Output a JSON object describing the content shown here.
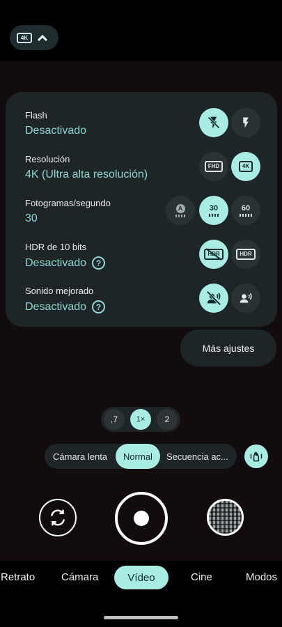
{
  "top_chip": {
    "resolution_badge": "4K"
  },
  "settings": [
    {
      "label": "Flash",
      "value": "Desactivado",
      "options": [
        {
          "icon": "flash-off-icon",
          "selected": true
        },
        {
          "icon": "flash-on-icon",
          "selected": false
        }
      ]
    },
    {
      "label": "Resolución",
      "value": "4K (Ultra alta resolución)",
      "options": [
        {
          "text": "FHD",
          "selected": false
        },
        {
          "text": "4K",
          "selected": true
        }
      ]
    },
    {
      "label": "Fotogramas/segundo",
      "value": "30",
      "options": [
        {
          "text": "A",
          "selected": false
        },
        {
          "text": "30",
          "selected": true
        },
        {
          "text": "60",
          "selected": false
        }
      ]
    },
    {
      "label": "HDR de 10 bits",
      "value": "Desactivado",
      "options": [
        {
          "text": "HDR",
          "selected": true
        },
        {
          "text": "HDR",
          "selected": false
        }
      ]
    },
    {
      "label": "Sonido mejorado",
      "value": "Desactivado",
      "options": [
        {
          "icon": "speech-off-icon",
          "selected": true
        },
        {
          "icon": "speech-enhance-icon",
          "selected": false
        }
      ]
    }
  ],
  "more_settings": "Más ajustes",
  "zoom": {
    "options": [
      ",7",
      "1×",
      "2"
    ],
    "selected": "1×"
  },
  "video_modes": {
    "options": [
      "Cámara lenta",
      "Normal",
      "Secuencia ac..."
    ],
    "selected": "Normal"
  },
  "bottom_modes": {
    "options": [
      "Retrato",
      "Cámara",
      "Vídeo",
      "Cine",
      "Modos"
    ],
    "selected": "Vídeo"
  }
}
